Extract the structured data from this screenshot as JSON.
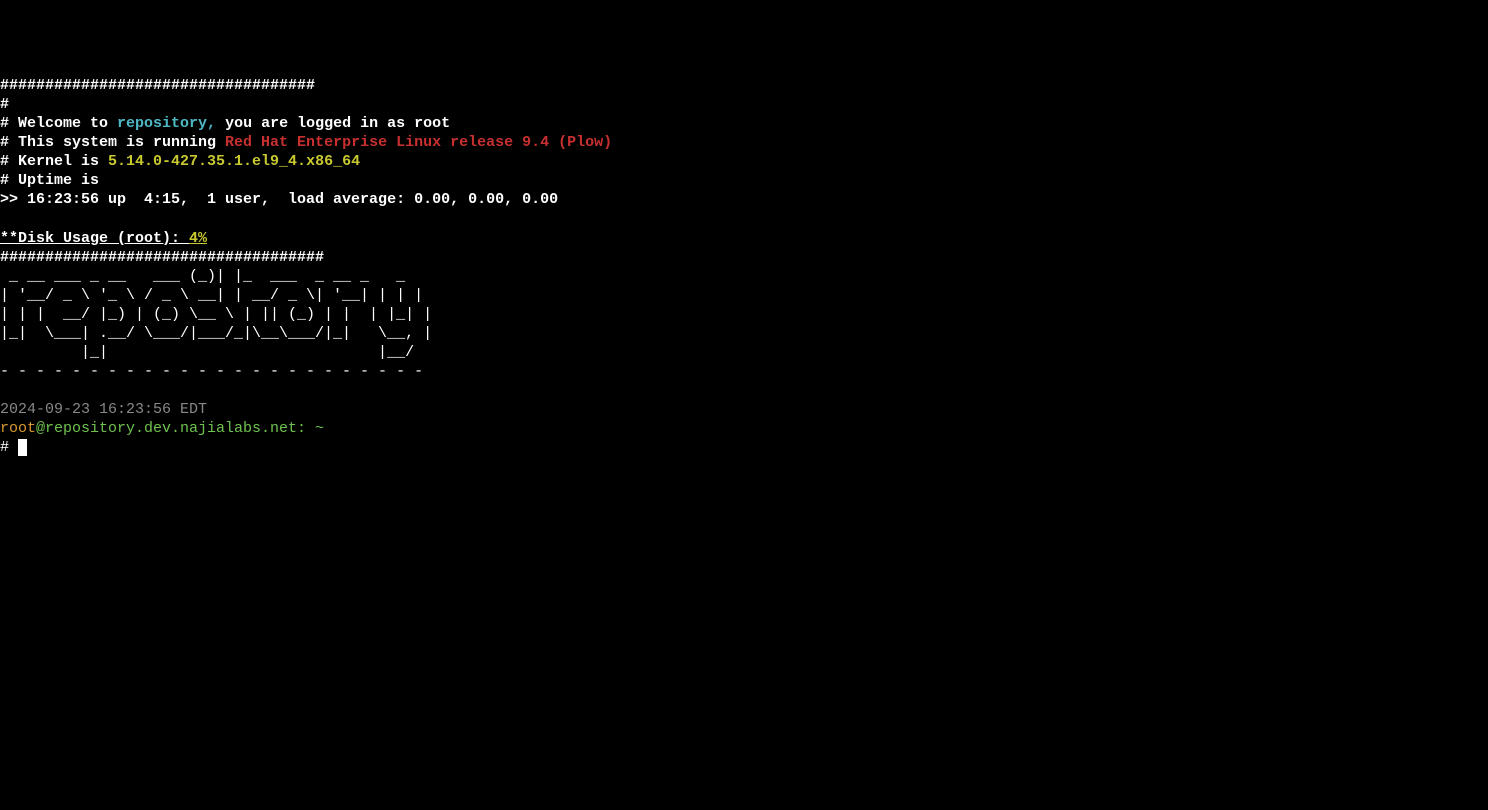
{
  "motd": {
    "hashline1": "###################################",
    "line2": "#",
    "line3_pre": "# Welcome to ",
    "hostname_short": "repository,",
    "line3_mid": " you are logged in as ",
    "user": "root",
    "line4_pre": "# This system is running ",
    "os_release": "Red Hat Enterprise Linux release 9.4 (Plow)",
    "line5_pre": "# Kernel is ",
    "kernel": "5.14.0-427.35.1.el9_4.x86_64",
    "line6": "# Uptime is",
    "uptime_line": ">> 16:23:56 up  4:15,  1 user,  load average: 0.00, 0.00, 0.00",
    "blank": "",
    "disk_pre": "**Disk Usage (root): ",
    "disk_pct": "4%",
    "hashline2": "####################################"
  },
  "ascii": {
    "l1": " _ __ ___ _ __   ___ (_)| |_  ___  _ __ _   _ ",
    "l2": "| '__/ _ \\ '_ \\ / _ \\ __| | __/ _ \\| '__| | | |",
    "l3": "| | |  __/ |_) | (_) \\__ \\ | || (_) | |  | |_| |",
    "l4": "|_|  \\___| .__/ \\___/|___/_|\\__\\___/|_|   \\__, |",
    "l5": "         |_|                              |__/ ",
    "l6": "- - - - - - - - - - - - - - - - - - - - - - - -"
  },
  "prompt": {
    "blank": "",
    "timestamp": "2024-09-23 16:23:56 EDT",
    "user": "root",
    "at_host": "@repository.dev.najialabs.net: ~",
    "ps1": "# "
  }
}
